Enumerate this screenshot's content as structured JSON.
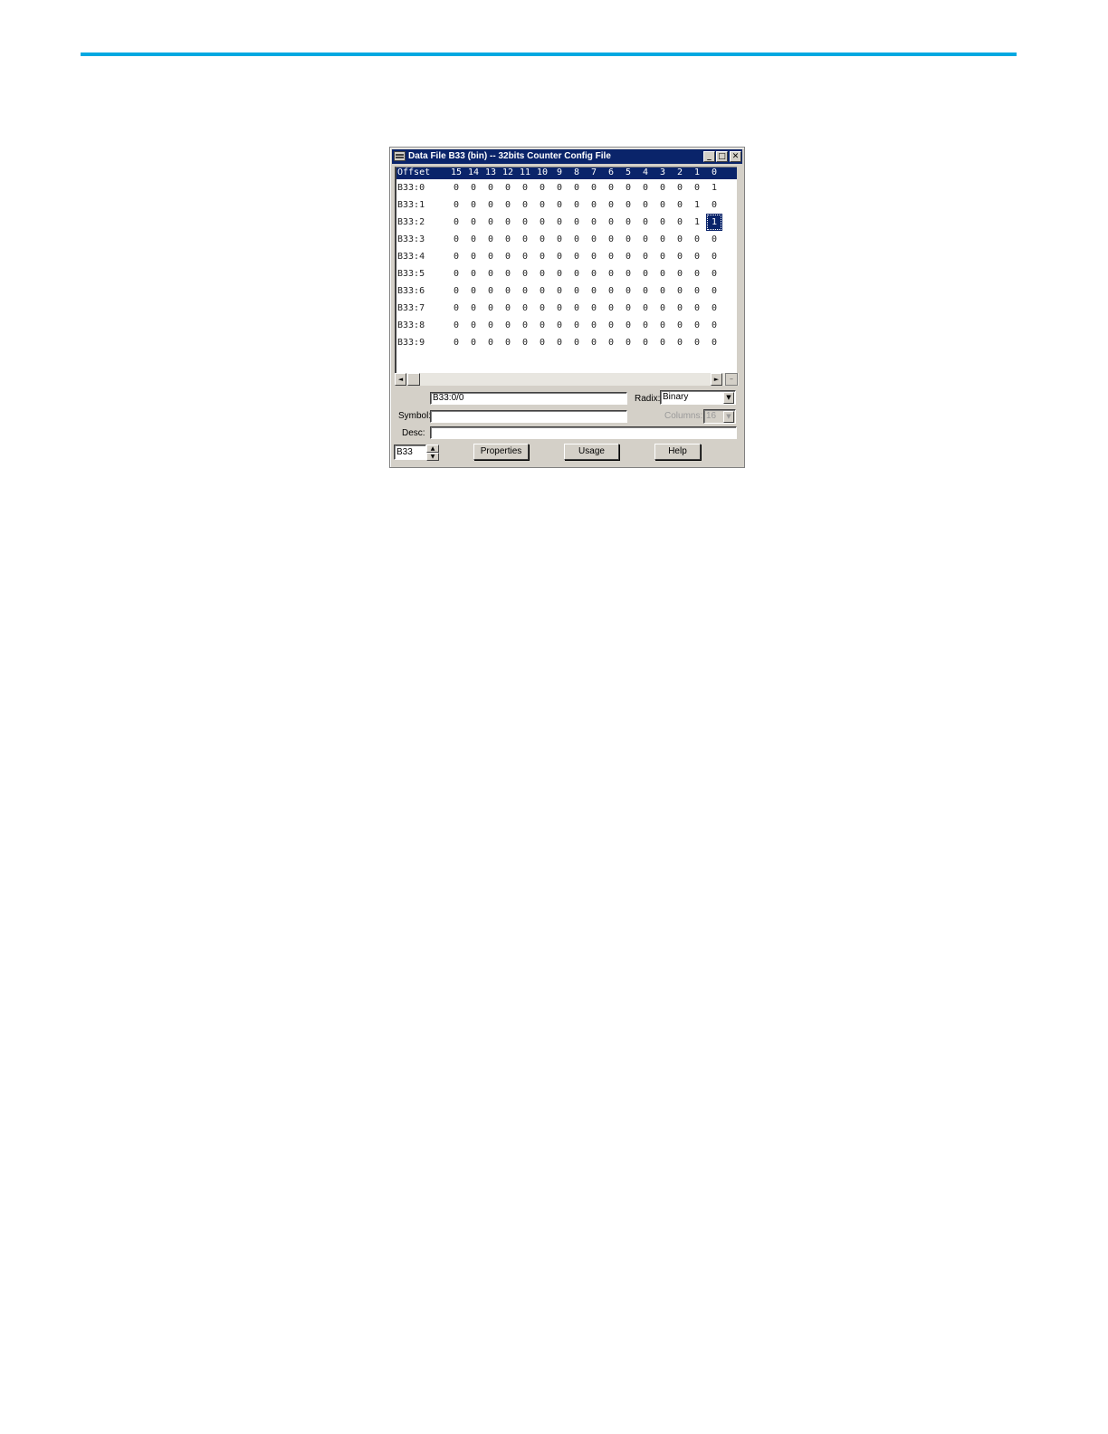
{
  "window": {
    "title": "Data File B33 (bin) -- 32bits Counter Config File",
    "min_glyph": "_",
    "max_glyph": "□",
    "close_glyph": "✕"
  },
  "grid": {
    "offset_header": "Offset",
    "columns": [
      "15",
      "14",
      "13",
      "12",
      "11",
      "10",
      "9",
      "8",
      "7",
      "6",
      "5",
      "4",
      "3",
      "2",
      "1",
      "0"
    ],
    "rows": [
      {
        "label": "B33:0",
        "bits": [
          "0",
          "0",
          "0",
          "0",
          "0",
          "0",
          "0",
          "0",
          "0",
          "0",
          "0",
          "0",
          "0",
          "0",
          "0",
          "1"
        ]
      },
      {
        "label": "B33:1",
        "bits": [
          "0",
          "0",
          "0",
          "0",
          "0",
          "0",
          "0",
          "0",
          "0",
          "0",
          "0",
          "0",
          "0",
          "0",
          "1",
          "0"
        ]
      },
      {
        "label": "B33:2",
        "bits": [
          "0",
          "0",
          "0",
          "0",
          "0",
          "0",
          "0",
          "0",
          "0",
          "0",
          "0",
          "0",
          "0",
          "0",
          "1",
          "1"
        ]
      },
      {
        "label": "B33:3",
        "bits": [
          "0",
          "0",
          "0",
          "0",
          "0",
          "0",
          "0",
          "0",
          "0",
          "0",
          "0",
          "0",
          "0",
          "0",
          "0",
          "0"
        ]
      },
      {
        "label": "B33:4",
        "bits": [
          "0",
          "0",
          "0",
          "0",
          "0",
          "0",
          "0",
          "0",
          "0",
          "0",
          "0",
          "0",
          "0",
          "0",
          "0",
          "0"
        ]
      },
      {
        "label": "B33:5",
        "bits": [
          "0",
          "0",
          "0",
          "0",
          "0",
          "0",
          "0",
          "0",
          "0",
          "0",
          "0",
          "0",
          "0",
          "0",
          "0",
          "0"
        ]
      },
      {
        "label": "B33:6",
        "bits": [
          "0",
          "0",
          "0",
          "0",
          "0",
          "0",
          "0",
          "0",
          "0",
          "0",
          "0",
          "0",
          "0",
          "0",
          "0",
          "0"
        ]
      },
      {
        "label": "B33:7",
        "bits": [
          "0",
          "0",
          "0",
          "0",
          "0",
          "0",
          "0",
          "0",
          "0",
          "0",
          "0",
          "0",
          "0",
          "0",
          "0",
          "0"
        ]
      },
      {
        "label": "B33:8",
        "bits": [
          "0",
          "0",
          "0",
          "0",
          "0",
          "0",
          "0",
          "0",
          "0",
          "0",
          "0",
          "0",
          "0",
          "0",
          "0",
          "0"
        ]
      },
      {
        "label": "B33:9",
        "bits": [
          "0",
          "0",
          "0",
          "0",
          "0",
          "0",
          "0",
          "0",
          "0",
          "0",
          "0",
          "0",
          "0",
          "0",
          "0",
          "0"
        ]
      }
    ],
    "selected": {
      "row": 2,
      "column": 15
    }
  },
  "scrollbar": {
    "left_glyph": "◄",
    "right_glyph": "►",
    "corner_glyph": "–"
  },
  "address": {
    "value": "B33:0/0"
  },
  "radix": {
    "label": "Radix:",
    "value": "Binary",
    "arrow": "▼"
  },
  "symbol": {
    "label": "Symbol:",
    "value": ""
  },
  "columns_select": {
    "label": "Columns:",
    "value": "16",
    "arrow": "▼"
  },
  "desc": {
    "label": "Desc:",
    "value": ""
  },
  "file_selector": {
    "value": "B33",
    "up": "▲",
    "down": "▼"
  },
  "buttons": {
    "properties": "Properties",
    "usage": "Usage",
    "help": "Help"
  },
  "colors": {
    "accent_rule": "#00a8e1",
    "titlebar": "#0a246a",
    "window_face": "#d4d0c8"
  }
}
